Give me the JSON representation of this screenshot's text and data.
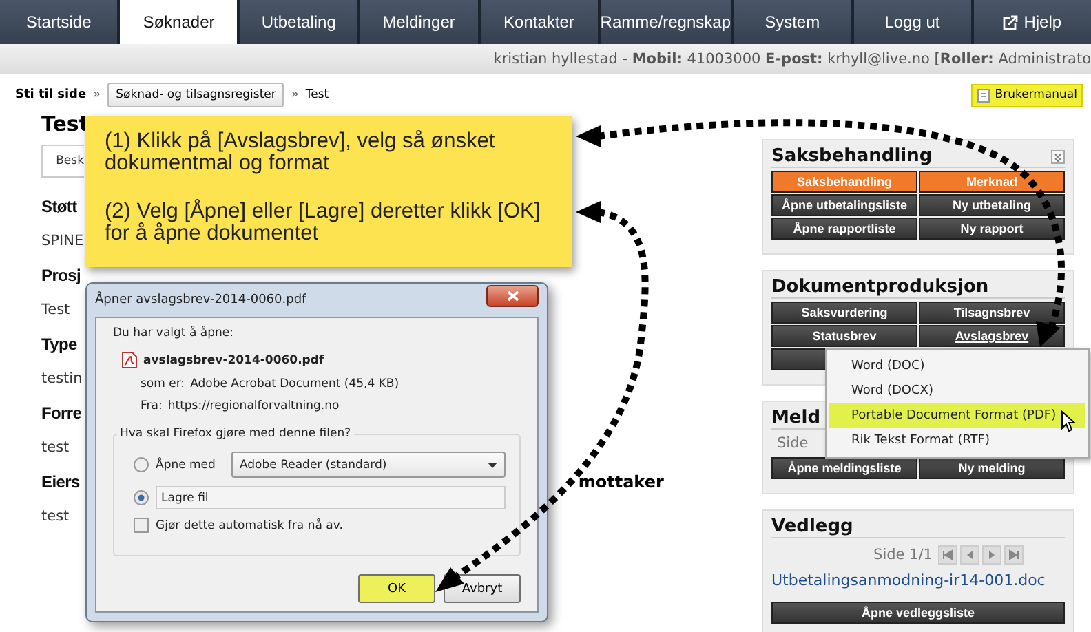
{
  "nav_tabs": [
    {
      "label": "Startside",
      "selected": false,
      "kind": "plain"
    },
    {
      "label": "Søknader",
      "selected": true,
      "kind": "plain"
    },
    {
      "label": "Utbetaling",
      "selected": false,
      "kind": "plain"
    },
    {
      "label": "Meldinger",
      "selected": false,
      "kind": "plain"
    },
    {
      "label": "Kontakter",
      "selected": false,
      "kind": "plain"
    },
    {
      "label": "Ramme/regnskap",
      "selected": false,
      "kind": "plain"
    },
    {
      "label": "System",
      "selected": false,
      "kind": "plain"
    },
    {
      "label": "Logg ut",
      "selected": false,
      "kind": "plain"
    },
    {
      "label": "Hjelp",
      "selected": false,
      "kind": "external"
    }
  ],
  "user_bar": "kristian hyllestad - **Mobil:** 41003000 **E-post:** krhyll@live.no [**Roller:** Administrato",
  "breadcrumb": {
    "label": "Sti til side",
    "items": [
      {
        "separator": "»",
        "label": "Søknad- og tilsagnsregister",
        "kind": "button"
      },
      {
        "separator": "»",
        "label": "Test",
        "kind": "text"
      }
    ]
  },
  "manual_button": "Brukermanual",
  "page": {
    "title": "Test",
    "tab": "Besk",
    "sections": [
      {
        "heading": "Støtt",
        "value": "SPINE"
      },
      {
        "heading": "Prosj",
        "value": "Test"
      },
      {
        "heading": "Type",
        "value": "testin"
      },
      {
        "heading": "Forre",
        "value": "test"
      },
      {
        "heading": "Eiers",
        "extra": "mottaker",
        "value": "test"
      }
    ]
  },
  "sidebar": [
    {
      "title": "Saksbehandling",
      "collapsible": true,
      "buttons": [
        {
          "label": "Saksbehandling",
          "kind": "orange",
          "underlined": false
        },
        {
          "label": "Merknad",
          "kind": "orange",
          "underlined": false
        },
        {
          "label": "Åpne utbetalingsliste",
          "kind": "dark",
          "underlined": false
        },
        {
          "label": "Ny utbetaling",
          "kind": "dark",
          "underlined": false
        },
        {
          "label": "Åpne rapportliste",
          "kind": "dark",
          "underlined": false
        },
        {
          "label": "Ny rapport",
          "kind": "dark",
          "underlined": false
        }
      ]
    },
    {
      "title": "Dokumentproduksjon",
      "collapsible": false,
      "buttons": [
        {
          "label": "Saksvurdering",
          "kind": "dark",
          "underlined": false
        },
        {
          "label": "Tilsagnsbrev",
          "kind": "dark",
          "underlined": false
        },
        {
          "label": "Statusbrev",
          "kind": "dark",
          "underlined": false
        },
        {
          "label": "Avslagsbrev",
          "kind": "dark",
          "underlined": true
        },
        {
          "kind": "dark"
        }
      ]
    },
    {
      "title": "Meld",
      "note": "Side",
      "buttons": [
        {
          "label": "Åpne meldingsliste",
          "kind": "dark",
          "underlined": false
        },
        {
          "label": "Ny melding",
          "kind": "dark",
          "underlined": false
        }
      ]
    },
    {
      "title": "Vedlegg",
      "collapsible": false,
      "pager": "Side 1/1",
      "link": "Utbetalingsanmodning-ir14-001.doc",
      "buttons": [
        {
          "label": "Åpne vedleggsliste",
          "kind": "wide",
          "underlined": false
        }
      ]
    }
  ],
  "dropdown_menu": [
    {
      "label": "Word (DOC)",
      "selected": false
    },
    {
      "label": "Word (DOCX)",
      "selected": false
    },
    {
      "label": "Portable Document Format (PDF)",
      "selected": true
    },
    {
      "label": "Rik Tekst Format (RTF)",
      "selected": false
    }
  ],
  "callout": [
    "(1) Klikk på [Avslagsbrev], velg så ønsket dokumentmal og format",
    "(2) Velg [Åpne] eller [Lagre] deretter klikk [OK] for å åpne dokumentet"
  ],
  "dialog": {
    "title": "Åpner avslagsbrev-2014-0060.pdf",
    "intro": "Du har valgt å åpne:",
    "file": "avslagsbrev-2014-0060.pdf",
    "details": [
      {
        "label": "som er:",
        "value": "Adobe Acrobat Document (45,4 KB)"
      },
      {
        "label": "Fra:",
        "value": "https://regionalforvaltning.no"
      }
    ],
    "question": "Hva skal Firefox gjøre med denne filen?",
    "options": [
      {
        "label": "Åpne med",
        "selected": false,
        "kind": "select",
        "app": "Adobe Reader  (standard)"
      },
      {
        "label": "Lagre fil",
        "selected": true,
        "kind": "field"
      }
    ],
    "auto": {
      "label": "Gjør dette automatisk fra nå av.",
      "checked": false
    },
    "buttons": [
      {
        "label": "OK",
        "highlighted": true
      },
      {
        "label": "Avbryt",
        "highlighted": false
      }
    ]
  }
}
